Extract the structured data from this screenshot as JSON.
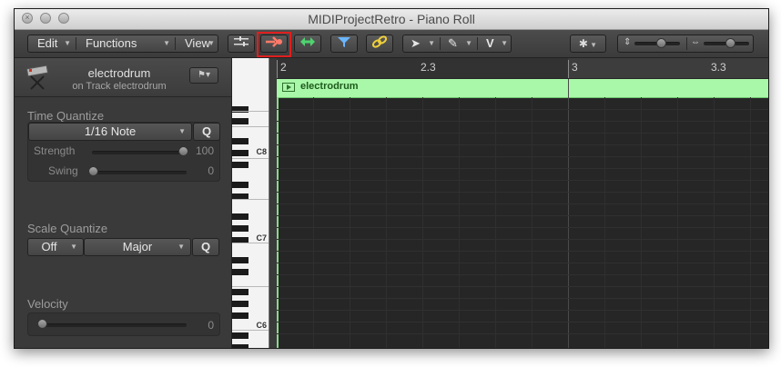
{
  "window": {
    "title": "MIDIProjectRetro - Piano Roll"
  },
  "toolbar": {
    "edit_label": "Edit",
    "functions_label": "Functions",
    "view_label": "View",
    "v_label": "V"
  },
  "inspector": {
    "region_name": "electrodrum",
    "region_subtitle": "on Track electrodrum",
    "time_quantize": {
      "label": "Time Quantize",
      "value": "1/16 Note",
      "q_label": "Q",
      "strength_label": "Strength",
      "strength_value": "100",
      "swing_label": "Swing",
      "swing_value": "0"
    },
    "scale_quantize": {
      "label": "Scale Quantize",
      "root_value": "Off",
      "scale_value": "Major",
      "q_label": "Q"
    },
    "velocity": {
      "label": "Velocity",
      "value": "0"
    }
  },
  "piano": {
    "labels": [
      "C8",
      "C7",
      "C6"
    ]
  },
  "ruler": {
    "markers": [
      "2",
      "2.3",
      "3",
      "3.3"
    ]
  },
  "region": {
    "title": "electrodrum",
    "color": "#a9f7a9"
  },
  "colors": {
    "highlight": "#e01e1e",
    "region_green": "#a9f7a9"
  }
}
